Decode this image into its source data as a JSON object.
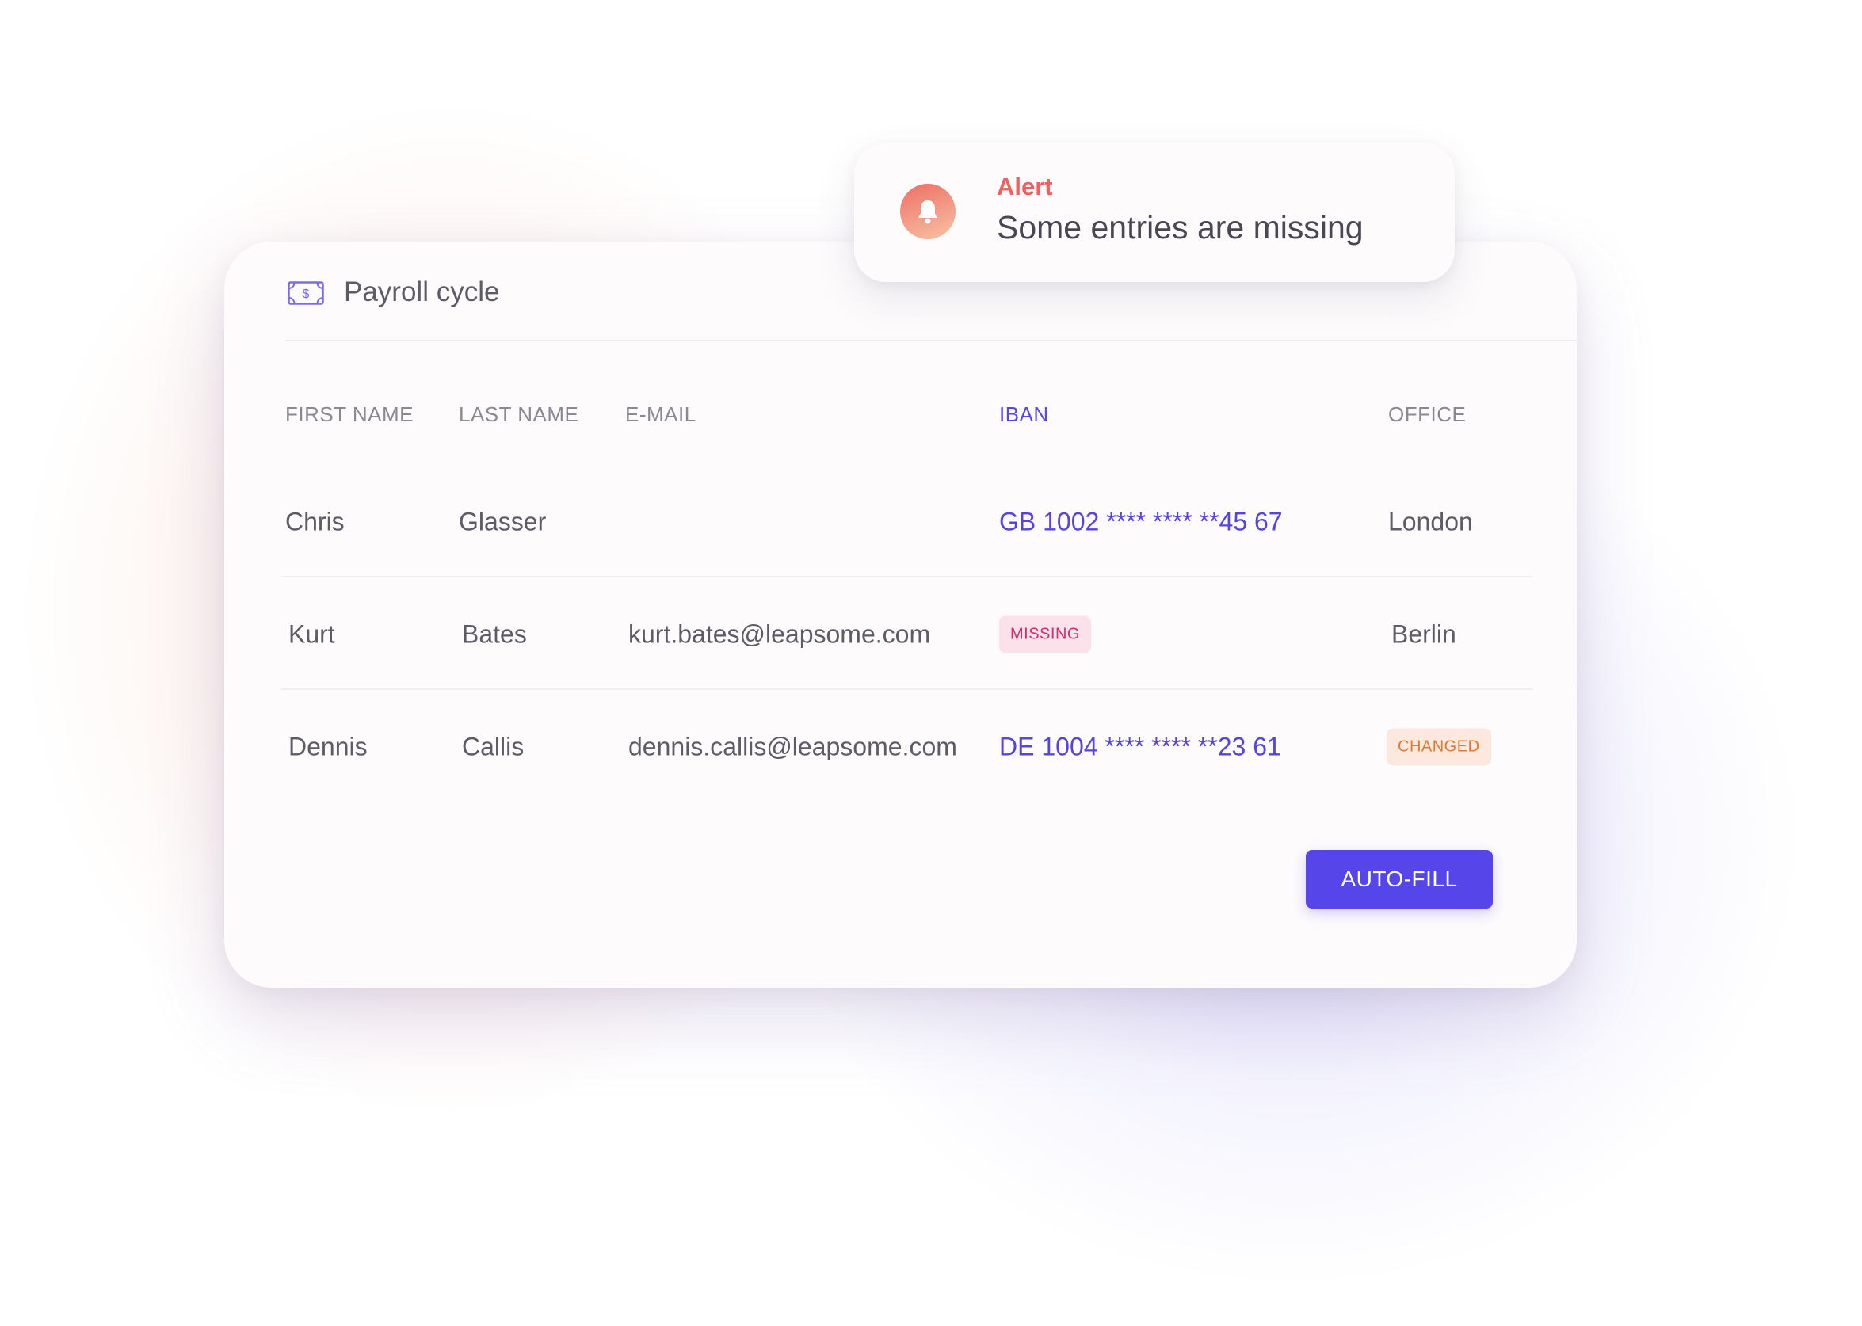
{
  "alert": {
    "label": "Alert",
    "message": "Some entries are missing",
    "icon": "bell-icon"
  },
  "card": {
    "title": "Payroll cycle",
    "icon": "money-icon"
  },
  "table": {
    "columns": [
      "FIRST NAME",
      "LAST NAME",
      "E-MAIL",
      "IBAN",
      "OFFICE"
    ],
    "rows": [
      {
        "first_name": "Chris",
        "last_name": "Glasser",
        "email": "",
        "iban": "GB 1002 **** **** **45 67",
        "office": "London"
      },
      {
        "first_name": "Kurt",
        "last_name": "Bates",
        "email": "kurt.bates@leapsome.com",
        "iban_status": "MISSING",
        "office": "Berlin"
      },
      {
        "first_name": "Dennis",
        "last_name": "Callis",
        "email": "dennis.callis@leapsome.com",
        "iban": "DE 1004 **** **** **23 61",
        "office_status": "CHANGED"
      }
    ]
  },
  "actions": {
    "autofill_label": "AUTO-FILL"
  },
  "colors": {
    "accent": "#5645e9",
    "alert": "#ee6161",
    "missing_badge_text": "#cc2f6e",
    "missing_badge_bg": "#fbe1ea",
    "changed_badge_text": "#e07a2c",
    "changed_badge_bg": "#fce8dc"
  }
}
